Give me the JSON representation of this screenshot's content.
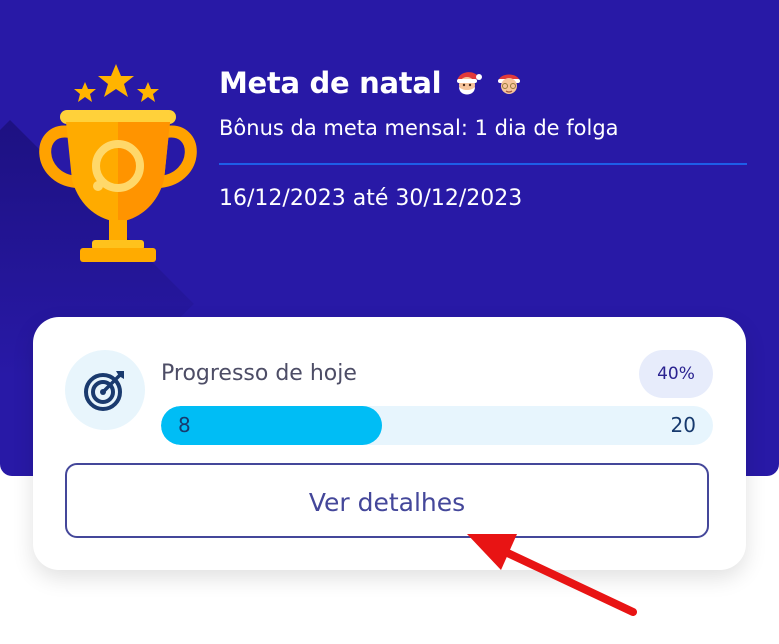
{
  "hero": {
    "title": "Meta de natal",
    "subtitle": "Bônus da meta mensal: 1 dia de folga",
    "date_range": "16/12/2023 até 30/12/2023",
    "icons": [
      "trophy-icon",
      "santa-emoji-icon",
      "mrs-claus-emoji-icon"
    ],
    "background_color": "#2819a6"
  },
  "progress_card": {
    "label": "Progresso de hoje",
    "percent_label": "40%",
    "current_value": "8",
    "target_value": "20",
    "progress_fraction": 0.4,
    "icon": "target-icon",
    "fill_color": "#00bdf5"
  },
  "actions": {
    "details_label": "Ver detalhes"
  },
  "annotation": {
    "icon": "red-arrow-icon",
    "color": "#e81414"
  }
}
